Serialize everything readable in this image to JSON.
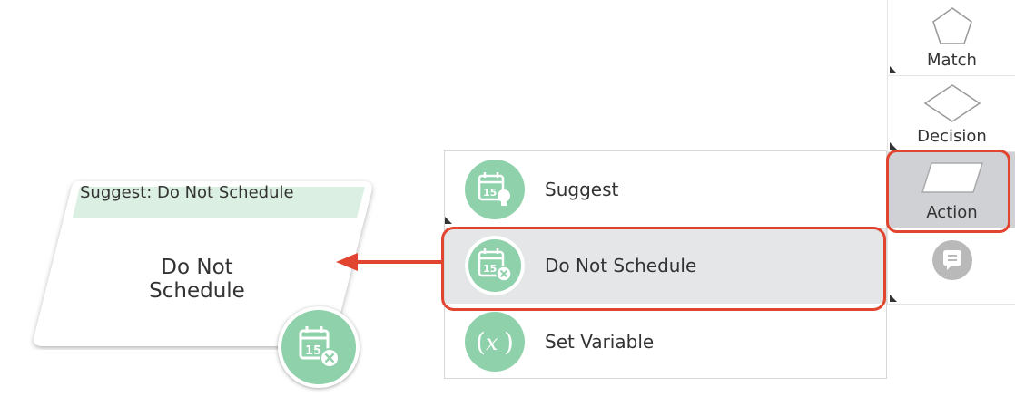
{
  "palette": {
    "items": [
      {
        "label": "Match",
        "icon": "pentagon-icon"
      },
      {
        "label": "Decision",
        "icon": "diamond-icon"
      },
      {
        "label": "Action",
        "icon": "parallelogram-icon"
      },
      {
        "label": "",
        "icon": "comment-icon"
      }
    ]
  },
  "menu": {
    "items": [
      {
        "label": "Suggest",
        "icon": "calendar-lightbulb-icon"
      },
      {
        "label": "Do Not Schedule",
        "icon": "calendar-x-icon"
      },
      {
        "label": "Set Variable",
        "icon": "variable-x-icon"
      }
    ]
  },
  "node": {
    "title": "Suggest: Do Not Schedule",
    "text": "Do Not Schedule",
    "icon": "calendar-x-icon"
  },
  "colors": {
    "accent_green": "#8fd1ab",
    "highlight_red": "#e2452f",
    "node_header": "#dcefe3"
  }
}
